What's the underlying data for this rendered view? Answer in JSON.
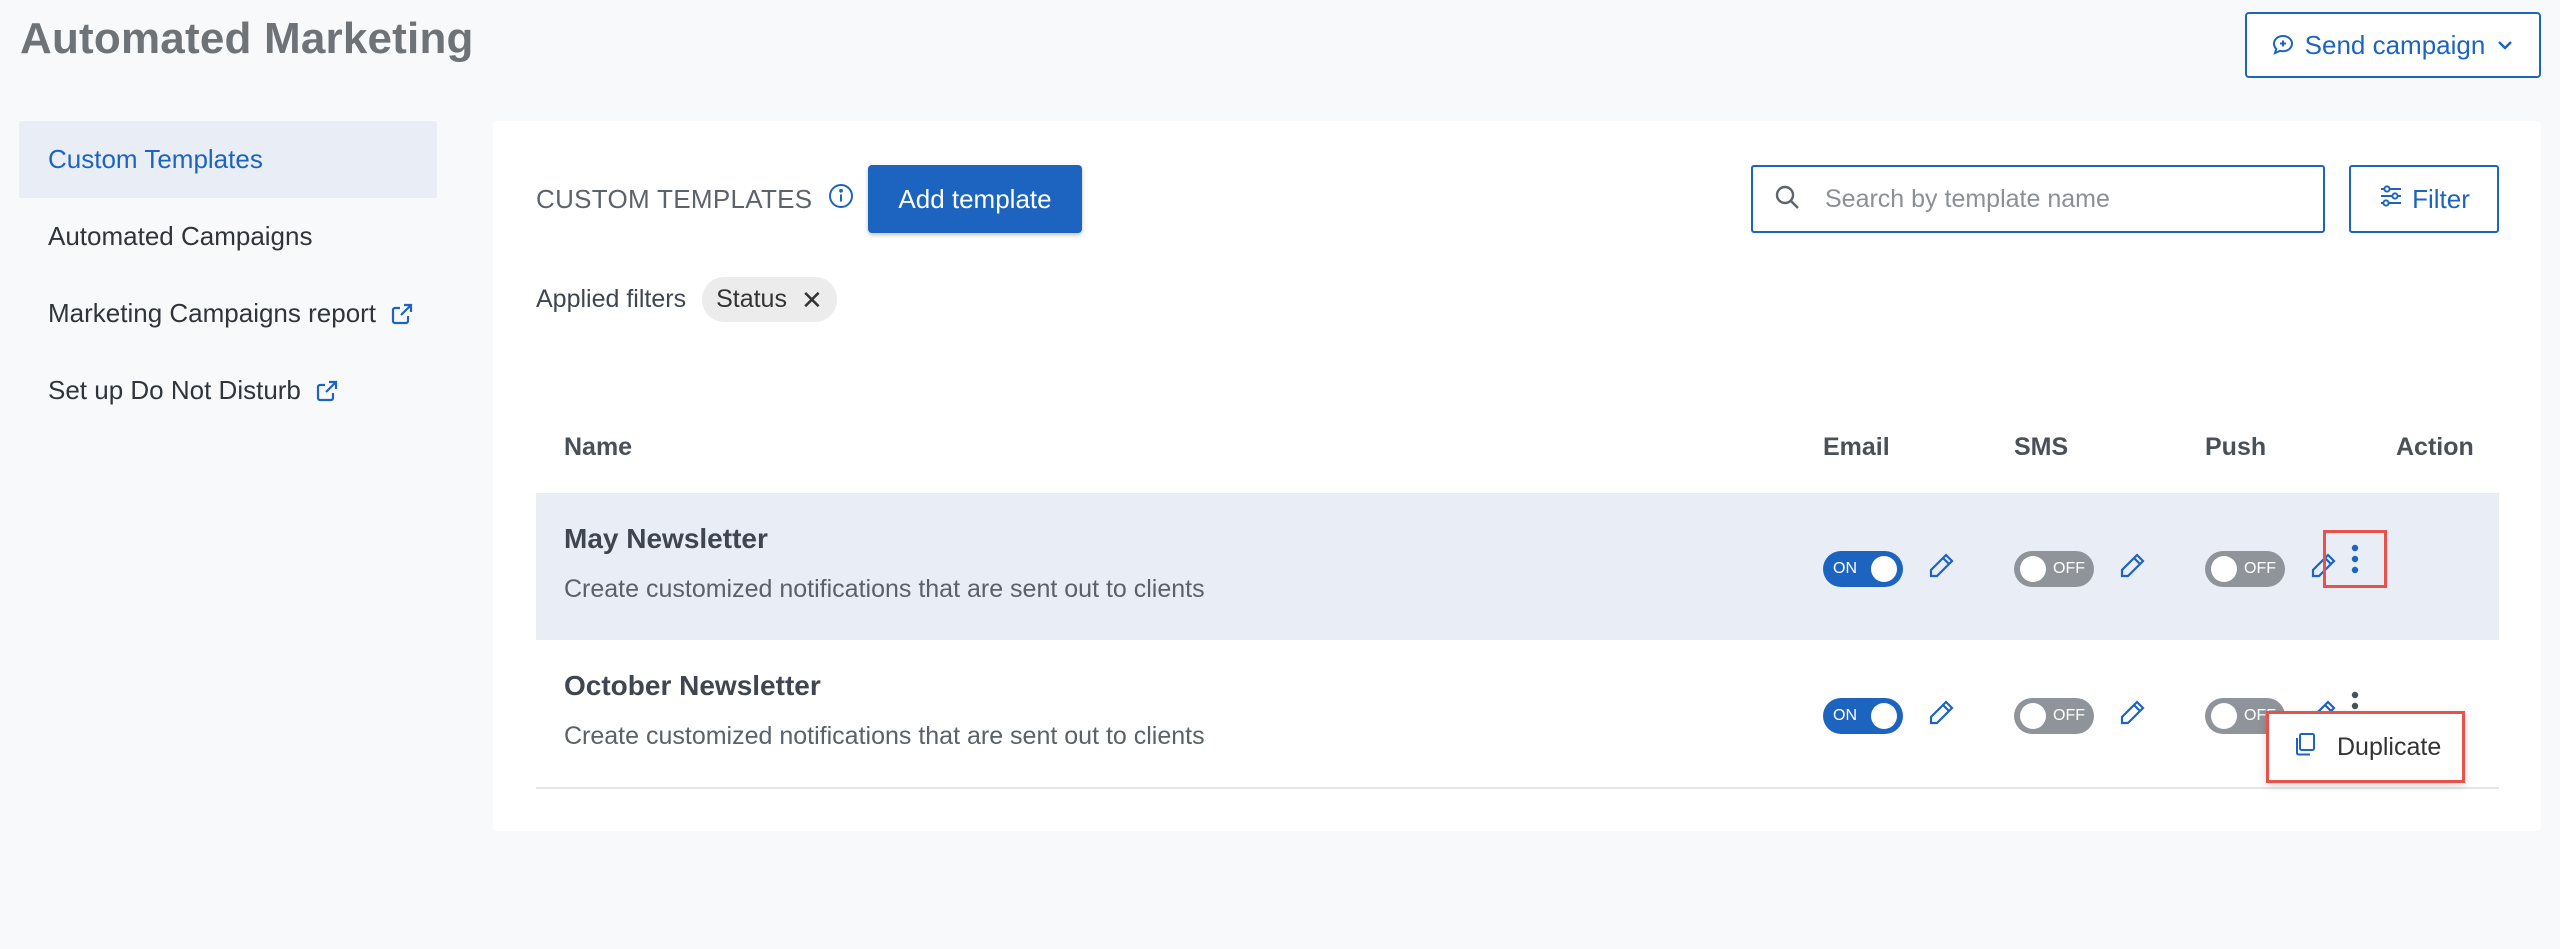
{
  "page": {
    "title": "Automated Marketing",
    "send_campaign_label": "Send campaign"
  },
  "sidebar": {
    "items": [
      {
        "label": "Custom Templates",
        "active": true
      },
      {
        "label": "Automated Campaigns"
      },
      {
        "label": "Marketing Campaigns report",
        "external": true
      },
      {
        "label": "Set up Do Not Disturb",
        "external": true
      }
    ]
  },
  "toolbar": {
    "section_title": "CUSTOM TEMPLATES",
    "add_template_label": "Add template",
    "search_placeholder": "Search by template name",
    "filter_label": "Filter"
  },
  "filters": {
    "applied_label": "Applied filters",
    "chips": [
      "Status"
    ]
  },
  "table": {
    "columns": [
      "Name",
      "Email",
      "SMS",
      "Push",
      "Action"
    ],
    "rows": [
      {
        "name": "May Newsletter",
        "description": "Create customized notifications that are sent out to clients",
        "email": "ON",
        "sms": "OFF",
        "push": "OFF"
      },
      {
        "name": "October Newsletter",
        "description": "Create customized notifications that are sent out to clients",
        "email": "ON",
        "sms": "OFF",
        "push": "OFF"
      }
    ]
  },
  "action_menu": {
    "items": [
      "Duplicate"
    ]
  },
  "colors": {
    "accent": "#1d64c1",
    "highlight_row": "#e9eef6",
    "annotation_red": "#e8524a",
    "toggle_off": "#8e9499"
  }
}
